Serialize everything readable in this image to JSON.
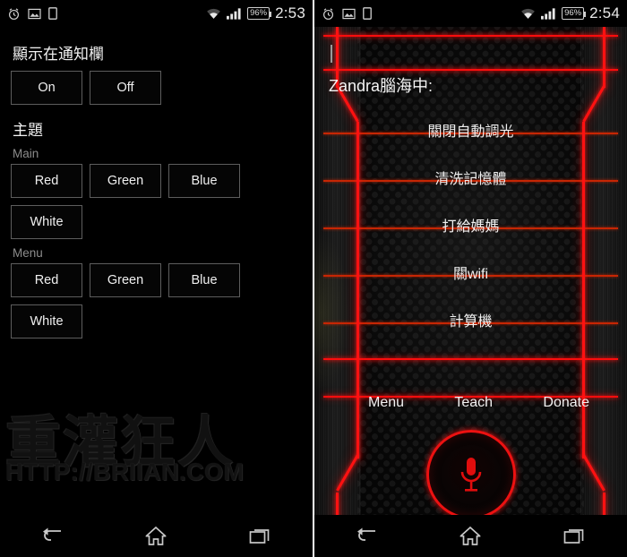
{
  "left_phone": {
    "status_bar": {
      "icons": [
        "alarm-icon",
        "screenshot-icon",
        "sim-card-icon"
      ],
      "wifi_icon": "wifi-icon",
      "signal_icon": "signal-bars-icon",
      "battery_label": "96%",
      "time": "2:53"
    },
    "settings": {
      "notification_section_title": "顯示在通知欄",
      "on_label": "On",
      "off_label": "Off",
      "theme_title": "主題",
      "main_label": "Main",
      "menu_label": "Menu",
      "main_colors": [
        "Red",
        "Green",
        "Blue",
        "White"
      ],
      "menu_colors": [
        "Red",
        "Green",
        "Blue",
        "White"
      ]
    },
    "watermark": {
      "chinese": "重灌狂人",
      "url": "HTTP://BRIIAN.COM"
    }
  },
  "right_phone": {
    "status_bar": {
      "icons": [
        "alarm-icon",
        "screenshot-icon",
        "sim-card-icon"
      ],
      "wifi_icon": "wifi-icon",
      "signal_icon": "signal-bars-icon",
      "battery_label": "96%",
      "time": "2:54"
    },
    "app": {
      "input_value": "",
      "prompt": "Zandra腦海中:",
      "suggestions": [
        "關閉自動調光",
        "清洗記憶體",
        "打給媽媽",
        "關wifi",
        "計算機"
      ],
      "menu_items": [
        "Menu",
        "Teach",
        "Donate"
      ],
      "mic_icon": "microphone-icon"
    }
  },
  "nav_bar": {
    "back": "back-icon",
    "home": "home-icon",
    "recents": "recents-icon"
  },
  "colors": {
    "neon_red": "#ff1111",
    "dim_red": "#c62604",
    "text": "#f2f2f2",
    "muted": "#8c8c8c",
    "button_border": "#5d5d5d"
  }
}
